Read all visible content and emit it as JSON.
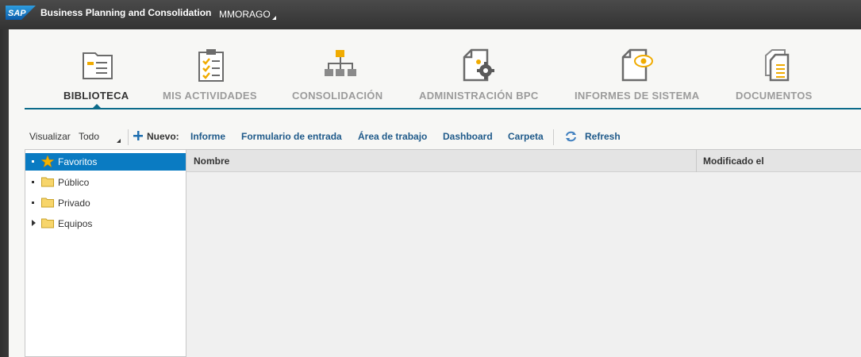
{
  "header": {
    "logo_text": "SAP",
    "app_title": "Business Planning and Consolidation",
    "user": "MMORAGO"
  },
  "nav": {
    "tabs": [
      {
        "label": "BIBLIOTECA",
        "icon": "library-icon",
        "active": true
      },
      {
        "label": "MIS ACTIVIDADES",
        "icon": "clipboard-checklist-icon",
        "active": false
      },
      {
        "label": "CONSOLIDACIÓN",
        "icon": "hierarchy-icon",
        "active": false
      },
      {
        "label": "ADMINISTRACIÓN BPC",
        "icon": "document-gear-icon",
        "active": false
      },
      {
        "label": "INFORMES DE SISTEMA",
        "icon": "document-eye-icon",
        "active": false
      },
      {
        "label": "DOCUMENTOS",
        "icon": "documents-stack-icon",
        "active": false
      }
    ]
  },
  "toolbar": {
    "visualizar_label": "Visualizar",
    "visualizar_value": "Todo",
    "nuevo_label": "Nuevo:",
    "links": [
      "Informe",
      "Formulario de entrada",
      "Área de trabajo",
      "Dashboard",
      "Carpeta"
    ],
    "refresh_label": "Refresh"
  },
  "tree": {
    "items": [
      {
        "label": "Favoritos",
        "icon": "star-icon",
        "selected": true
      },
      {
        "label": "Público",
        "icon": "folder-icon",
        "selected": false
      },
      {
        "label": "Privado",
        "icon": "folder-icon",
        "selected": false
      },
      {
        "label": "Equipos",
        "icon": "folder-icon",
        "selected": false,
        "expandable": true
      }
    ]
  },
  "grid": {
    "columns": [
      "Nombre",
      "Modificado el"
    ]
  },
  "colors": {
    "accent": "#0c6b8a",
    "selection": "#0a7bc2",
    "icon_orange": "#f0ab00",
    "icon_gray": "#6b6b6b",
    "link": "#1f5a8a"
  }
}
